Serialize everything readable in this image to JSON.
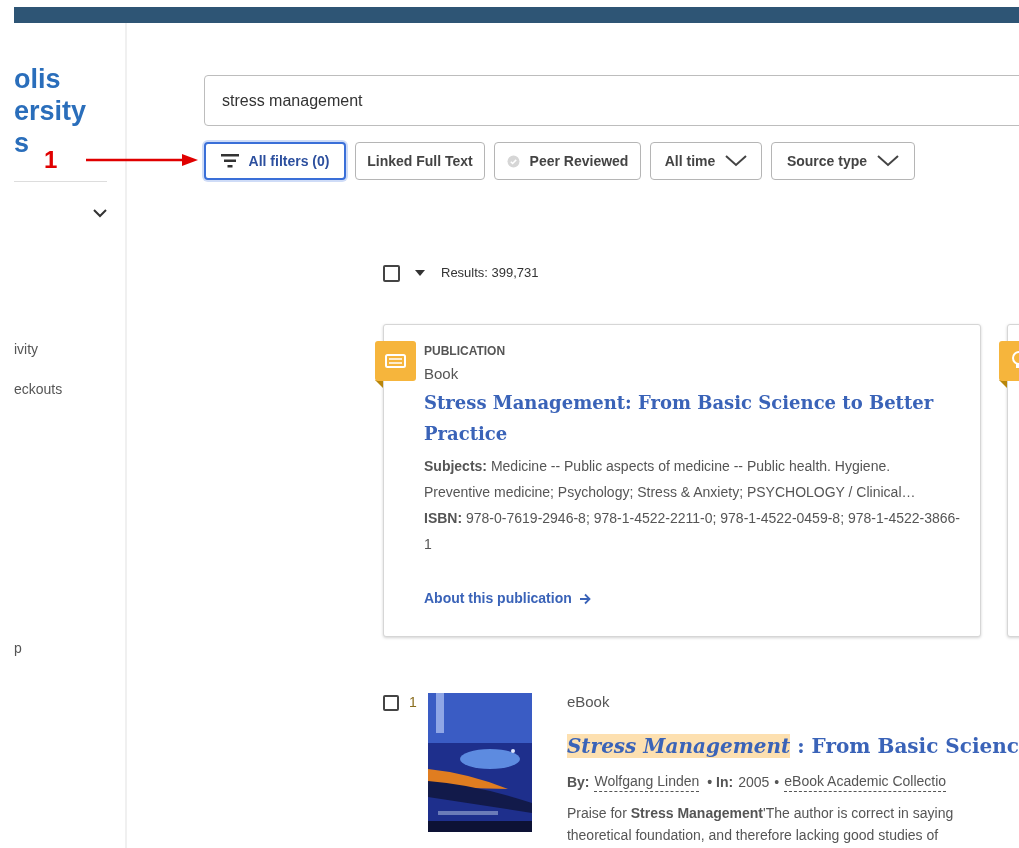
{
  "logo_lines": [
    "olis",
    "ersity",
    "s"
  ],
  "sidebar": {
    "items": [
      {
        "label": "ivity"
      },
      {
        "label": "eckouts"
      },
      {
        "label": "p"
      }
    ]
  },
  "annotation": {
    "label": "1"
  },
  "search": {
    "value": "stress management"
  },
  "filters": [
    {
      "label": "All filters (0)",
      "kind": "filters",
      "selected": true
    },
    {
      "label": "Linked Full Text",
      "kind": "toggle",
      "selected": false
    },
    {
      "label": "Peer Reviewed",
      "kind": "verified",
      "selected": false
    },
    {
      "label": "All time",
      "kind": "dropdown",
      "selected": false
    },
    {
      "label": "Source type",
      "kind": "dropdown",
      "selected": false
    }
  ],
  "results_bar": {
    "select_all_checked": false,
    "count": "Results: 399,731"
  },
  "publication_card": {
    "label": "PUBLICATION",
    "type": "Book",
    "title": "Stress Management: From Basic Science to Better Practice",
    "subjects": "**Subjects:** Medicine -- Public aspects of medicine -- Public health. Hygiene. Preventive medicine; Psychology; Stress & Anxiety; PSYCHOLOGY / Clinical…",
    "isbn": "**ISBN:** 978-0-7619-2946-8; 978-1-4522-2211-0; 978-1-4522-0459-8; 978-1-4522-3866-1",
    "link": "About this publication"
  },
  "results": [
    {
      "number": "1",
      "checked": false,
      "type": "eBook",
      "title_highlight": "Stress Management",
      "title_rest": " : From Basic Scienc",
      "by_label": "By:",
      "author": "Wolfgang Linden",
      "in_label": "• In:",
      "separator": "•",
      "year": "2005",
      "collection": "eBook Academic Collectio",
      "snippet_lines": [
        "Praise for **Stress Management**'The author is correct in saying",
        "theoretical foundation, and therefore lacking good studies of"
      ]
    }
  ]
}
